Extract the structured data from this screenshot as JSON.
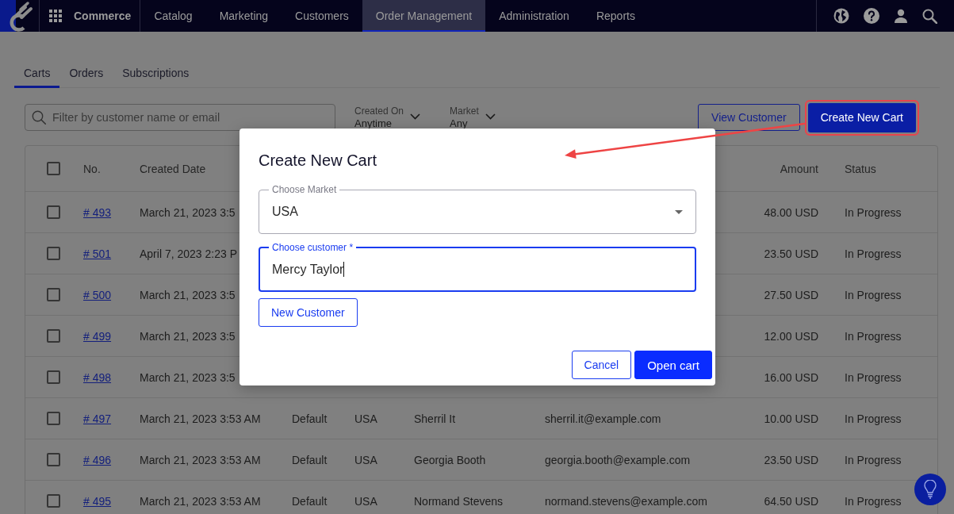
{
  "nav": {
    "app_name": "Commerce",
    "items": [
      {
        "label": "Catalog",
        "selected": false
      },
      {
        "label": "Marketing",
        "selected": false
      },
      {
        "label": "Customers",
        "selected": false
      },
      {
        "label": "Order Management",
        "selected": true
      },
      {
        "label": "Administration",
        "selected": false
      },
      {
        "label": "Reports",
        "selected": false
      }
    ]
  },
  "tabs": [
    {
      "label": "Carts",
      "selected": true
    },
    {
      "label": "Orders",
      "selected": false
    },
    {
      "label": "Subscriptions",
      "selected": false
    }
  ],
  "filters": {
    "search": {
      "placeholder": "Filter by customer name or email"
    },
    "dropdowns": [
      {
        "label": "Created On",
        "value": "Anytime"
      },
      {
        "label": "Market",
        "value": "Any"
      }
    ]
  },
  "actions": [
    {
      "label": "View Customer",
      "kind": "outline",
      "highlighted": false
    },
    {
      "label": "Create New Cart",
      "kind": "primary",
      "highlighted": true
    }
  ],
  "table": {
    "header": {
      "checked": false,
      "no": "No.",
      "created_date": "Created Date",
      "amount": "Amount",
      "status": "Status"
    },
    "rows": [
      {
        "checked": false,
        "no": "# 493",
        "created_date": "March 21, 2023 3:5",
        "amount": "48.00 USD",
        "status": "In Progress"
      },
      {
        "checked": false,
        "no": "# 501",
        "created_date": "April 7, 2023 2:23 P",
        "amount": "23.50 USD",
        "status": "In Progress"
      },
      {
        "checked": false,
        "no": "# 500",
        "created_date": "March 21, 2023 3:5",
        "amount": "27.50 USD",
        "status": "In Progress"
      },
      {
        "checked": false,
        "no": "# 499",
        "created_date": "March 21, 2023 3:5",
        "amount": "12.00 USD",
        "status": "In Progress"
      },
      {
        "checked": false,
        "no": "# 498",
        "created_date": "March 21, 2023 3:5",
        "amount": "16.00 USD",
        "status": "In Progress"
      },
      {
        "checked": false,
        "no": "# 497",
        "created_date": "March 21, 2023 3:53 AM",
        "column_3": "Default",
        "column_4": "USA",
        "column_5": "Sherril It",
        "column_6": "sherril.it@example.com",
        "amount": "10.00 USD",
        "status": "In Progress"
      },
      {
        "checked": false,
        "no": "# 496",
        "created_date": "March 21, 2023 3:53 AM",
        "column_3": "Default",
        "column_4": "USA",
        "column_5": "Georgia Booth",
        "column_6": "georgia.booth@example.com",
        "amount": "23.50 USD",
        "status": "In Progress"
      },
      {
        "checked": false,
        "no": "# 495",
        "created_date": "March 21, 2023 3:53 AM",
        "column_3": "Default",
        "column_4": "USA",
        "column_5": "Normand Stevens",
        "column_6": "normand.stevens@example.com",
        "amount": "64.50 USD",
        "status": "In Progress"
      }
    ]
  },
  "dialog": {
    "title": "Create New Cart",
    "fields": [
      {
        "kind": "select",
        "label": "Choose Market",
        "value": "USA",
        "focused": false
      },
      {
        "kind": "text",
        "label": "Choose customer *",
        "value": "Mercy Taylor",
        "focused": true
      }
    ],
    "extra_button": {
      "label": "New Customer",
      "kind": "outline"
    },
    "buttons": [
      {
        "label": "Cancel",
        "kind": "outline"
      },
      {
        "label": "Open cart",
        "kind": "primary"
      }
    ]
  }
}
